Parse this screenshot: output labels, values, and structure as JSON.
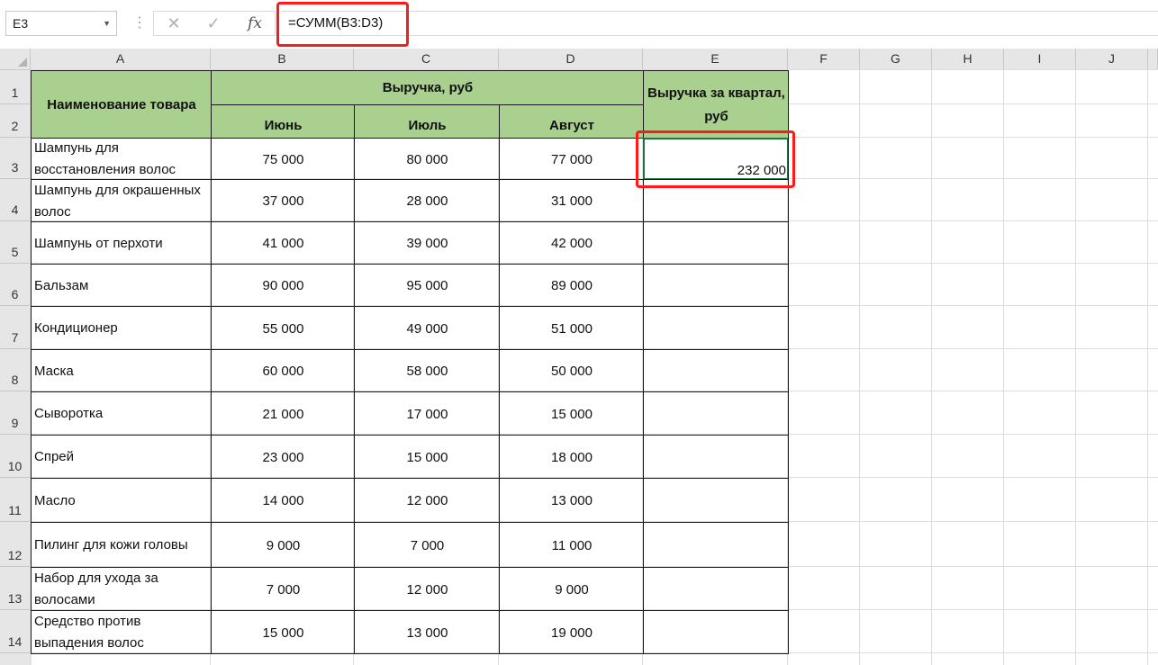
{
  "formula_bar": {
    "name_box": "E3",
    "cancel_icon": "✕",
    "enter_icon": "✓",
    "fx_label": "fx",
    "formula": "=СУММ(B3:D3)"
  },
  "columns": [
    "A",
    "B",
    "C",
    "D",
    "E",
    "F",
    "G",
    "H",
    "I",
    "J"
  ],
  "rows": [
    "1",
    "2",
    "3",
    "4",
    "5",
    "6",
    "7",
    "8",
    "9",
    "10",
    "11",
    "12",
    "13",
    "14"
  ],
  "table": {
    "header_name": "Наименование товара",
    "header_revenue": "Выручка, руб",
    "months": [
      "Июнь",
      "Июль",
      "Август"
    ],
    "header_quarter": "Выручка за квартал, руб",
    "data": [
      {
        "name": "Шампунь для восстановления волос",
        "jun": "75 000",
        "jul": "80 000",
        "aug": "77 000",
        "total": "232 000"
      },
      {
        "name": "Шампунь для окрашенных волос",
        "jun": "37 000",
        "jul": "28 000",
        "aug": "31 000",
        "total": ""
      },
      {
        "name": "Шампунь от перхоти",
        "jun": "41 000",
        "jul": "39 000",
        "aug": "42 000",
        "total": ""
      },
      {
        "name": "Бальзам",
        "jun": "90 000",
        "jul": "95 000",
        "aug": "89 000",
        "total": ""
      },
      {
        "name": "Кондиционер",
        "jun": "55 000",
        "jul": "49 000",
        "aug": "51 000",
        "total": ""
      },
      {
        "name": "Маска",
        "jun": "60 000",
        "jul": "58 000",
        "aug": "50 000",
        "total": ""
      },
      {
        "name": "Сыворотка",
        "jun": "21 000",
        "jul": "17 000",
        "aug": "15 000",
        "total": ""
      },
      {
        "name": "Спрей",
        "jun": "23 000",
        "jul": "15 000",
        "aug": "18 000",
        "total": ""
      },
      {
        "name": "Масло",
        "jun": "14 000",
        "jul": "12 000",
        "aug": "13 000",
        "total": ""
      },
      {
        "name": "Пилинг для кожи головы",
        "jun": "9 000",
        "jul": "7 000",
        "aug": "11 000",
        "total": ""
      },
      {
        "name": "Набор для ухода за волосами",
        "jun": "7 000",
        "jul": "12 000",
        "aug": "9 000",
        "total": ""
      },
      {
        "name": "Средство против выпадения волос",
        "jun": "15 000",
        "jul": "13 000",
        "aug": "19 000",
        "total": ""
      }
    ]
  },
  "colors": {
    "header_fill": "#a9d08e",
    "annotation": "#ff1a1a",
    "selection": "#217346"
  }
}
